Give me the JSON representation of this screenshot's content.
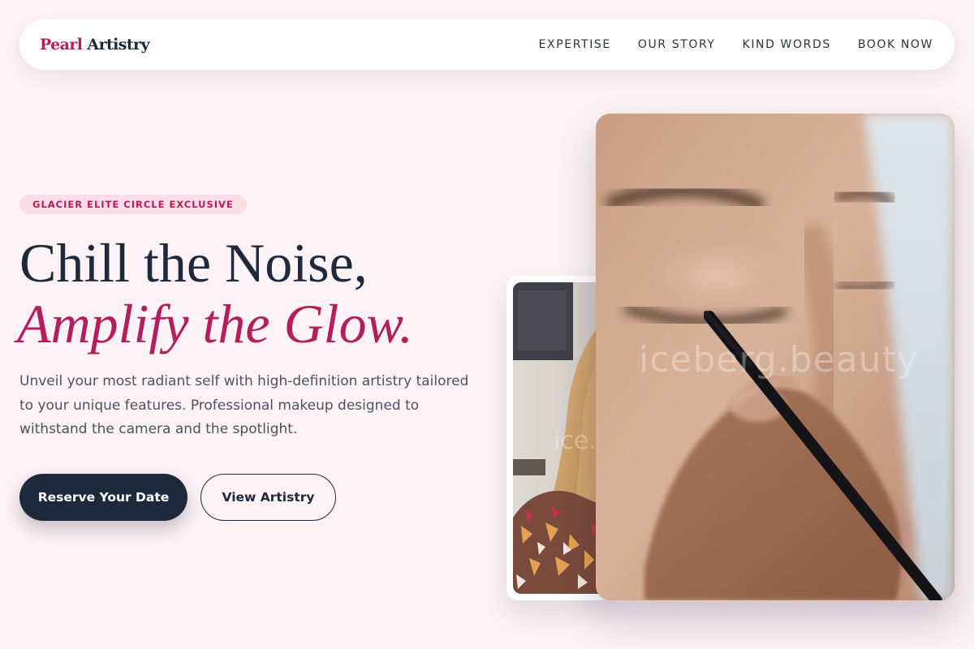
{
  "brand": {
    "logo_accent": "Pearl",
    "logo_main": "Artistry",
    "accent_color": "#b31e5c",
    "dark_color": "#1e293b"
  },
  "nav": {
    "items": [
      {
        "label": "EXPERTISE"
      },
      {
        "label": "OUR STORY"
      },
      {
        "label": "KIND WORDS"
      },
      {
        "label": "BOOK NOW"
      }
    ]
  },
  "hero": {
    "badge": "GLACIER ELITE CIRCLE EXCLUSIVE",
    "headline_line1": "Chill the Noise,",
    "headline_line2": "Amplify the Glow.",
    "description": "Unveil your most radiant self with high-definition artistry tailored to your unique features. Professional makeup designed to withstand the camera and the spotlight.",
    "primary_cta": "Reserve Your Date",
    "secondary_cta": "View Artistry"
  },
  "gallery": {
    "front_photo_watermark": "iceberg.beauty",
    "back_photo_watermark": "ice..."
  }
}
